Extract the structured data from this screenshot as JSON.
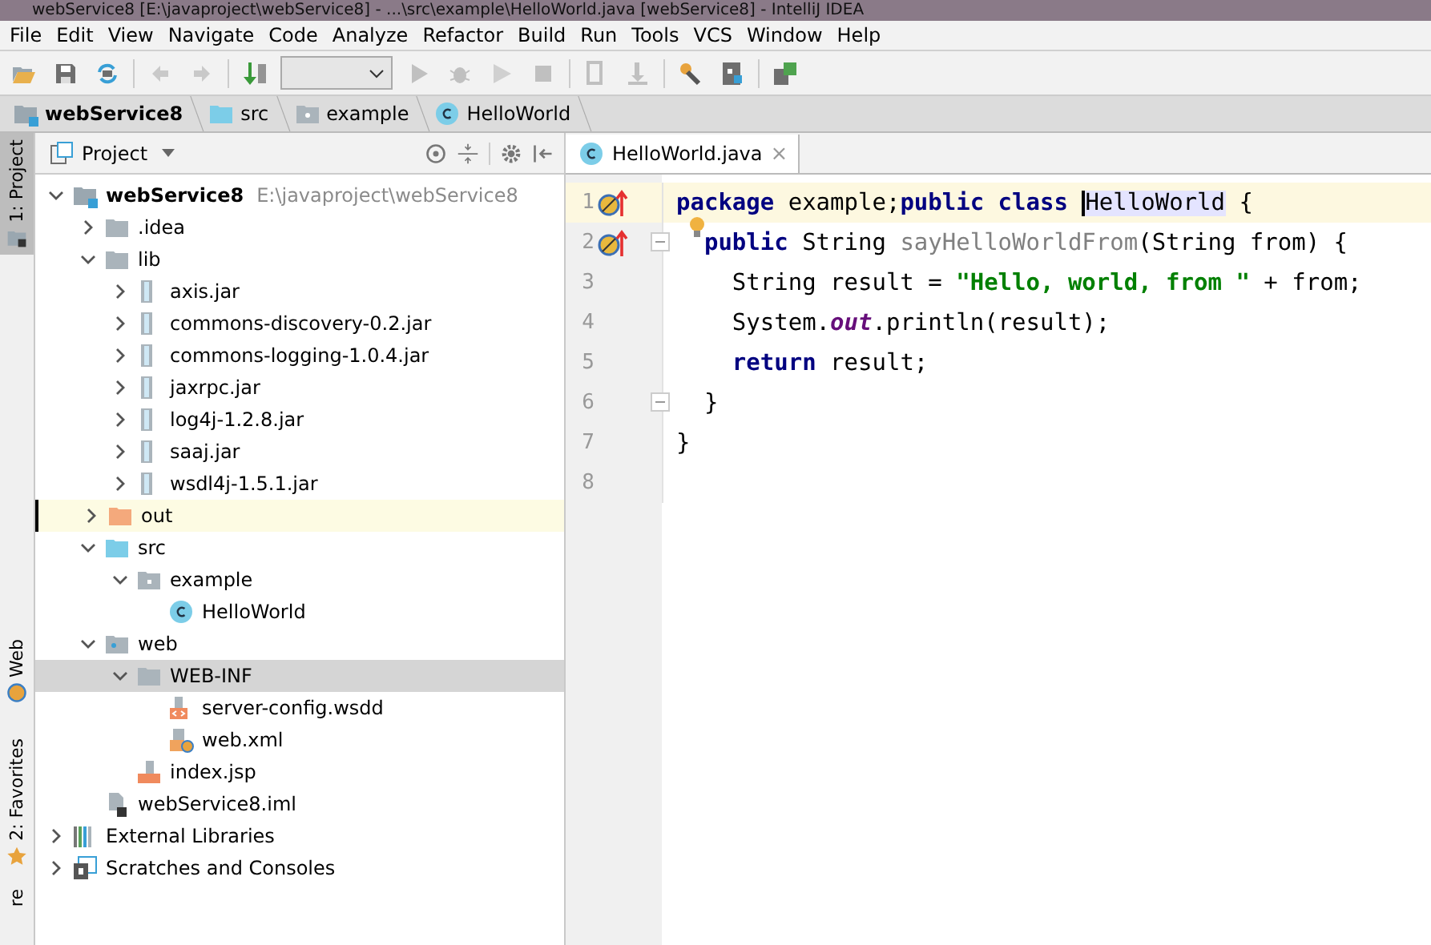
{
  "window": {
    "title": "webService8 [E:\\javaproject\\webService8] - ...\\src\\example\\HelloWorld.java [webService8] - IntelliJ IDEA"
  },
  "menu": [
    "File",
    "Edit",
    "View",
    "Navigate",
    "Code",
    "Analyze",
    "Refactor",
    "Build",
    "Run",
    "Tools",
    "VCS",
    "Window",
    "Help"
  ],
  "breadcrumb": [
    {
      "label": "webService8",
      "kind": "module"
    },
    {
      "label": "src",
      "kind": "source"
    },
    {
      "label": "example",
      "kind": "package"
    },
    {
      "label": "HelloWorld",
      "kind": "class"
    }
  ],
  "side_tabs": [
    {
      "label": "1: Project",
      "kind": "project",
      "selected": true
    },
    {
      "label": "Web",
      "kind": "web",
      "selected": false
    },
    {
      "label": "2: Favorites",
      "kind": "star",
      "selected": false
    },
    {
      "label": "re",
      "kind": "plain",
      "selected": false
    }
  ],
  "project_panel": {
    "title": "Project",
    "tree": [
      {
        "label": "webService8",
        "path": "E:\\javaproject\\webService8",
        "kind": "module",
        "expanded": true,
        "selected": false,
        "highlighted": false,
        "children": [
          {
            "label": ".idea",
            "kind": "folder",
            "expanded": false,
            "selected": false,
            "highlighted": false
          },
          {
            "label": "lib",
            "kind": "folder",
            "expanded": true,
            "selected": false,
            "highlighted": false,
            "children": [
              {
                "label": "axis.jar",
                "kind": "jar",
                "expanded": false,
                "selected": false,
                "highlighted": false
              },
              {
                "label": "commons-discovery-0.2.jar",
                "kind": "jar",
                "expanded": false,
                "selected": false,
                "highlighted": false
              },
              {
                "label": "commons-logging-1.0.4.jar",
                "kind": "jar",
                "expanded": false,
                "selected": false,
                "highlighted": false
              },
              {
                "label": "jaxrpc.jar",
                "kind": "jar",
                "expanded": false,
                "selected": false,
                "highlighted": false
              },
              {
                "label": "log4j-1.2.8.jar",
                "kind": "jar",
                "expanded": false,
                "selected": false,
                "highlighted": false
              },
              {
                "label": "saaj.jar",
                "kind": "jar",
                "expanded": false,
                "selected": false,
                "highlighted": false
              },
              {
                "label": "wsdl4j-1.5.1.jar",
                "kind": "jar",
                "expanded": false,
                "selected": false,
                "highlighted": false
              }
            ]
          },
          {
            "label": "out",
            "kind": "excluded",
            "expanded": false,
            "selected": false,
            "highlighted": true
          },
          {
            "label": "src",
            "kind": "source",
            "expanded": true,
            "selected": false,
            "highlighted": false,
            "children": [
              {
                "label": "example",
                "kind": "package",
                "expanded": true,
                "selected": false,
                "highlighted": false,
                "children": [
                  {
                    "label": "HelloWorld",
                    "kind": "class",
                    "selected": false,
                    "highlighted": false
                  }
                ]
              }
            ]
          },
          {
            "label": "web",
            "kind": "webfolder",
            "expanded": true,
            "selected": false,
            "highlighted": false,
            "children": [
              {
                "label": "WEB-INF",
                "kind": "folder",
                "expanded": true,
                "selected": true,
                "highlighted": false,
                "children": [
                  {
                    "label": "server-config.wsdd",
                    "kind": "xml",
                    "selected": false,
                    "highlighted": false
                  },
                  {
                    "label": "web.xml",
                    "kind": "webxml",
                    "selected": false,
                    "highlighted": false
                  }
                ]
              },
              {
                "label": "index.jsp",
                "kind": "jsp",
                "selected": false,
                "highlighted": false
              }
            ]
          },
          {
            "label": "webService8.iml",
            "kind": "iml",
            "selected": false,
            "highlighted": false
          }
        ]
      },
      {
        "label": "External Libraries",
        "kind": "libraries",
        "expanded": false,
        "selected": false,
        "highlighted": false
      },
      {
        "label": "Scratches and Consoles",
        "kind": "scratches",
        "expanded": false,
        "selected": false,
        "highlighted": false
      }
    ]
  },
  "editor": {
    "tabs": [
      {
        "label": "HelloWorld.java",
        "close": "×",
        "selected": true
      }
    ],
    "lines": [
      {
        "number": "1",
        "current": true,
        "gutter_icon": true,
        "tokens": [
          {
            "kind": "keyword",
            "text": "package"
          },
          {
            "kind": "text",
            "text": " example;"
          },
          {
            "kind": "keyword",
            "text": "public class "
          },
          {
            "kind": "highlight",
            "text": "HelloWorld"
          },
          {
            "kind": "text",
            "text": " {"
          }
        ]
      },
      {
        "number": "2",
        "current": false,
        "gutter_icon": true,
        "bulb": true,
        "fold": true,
        "tokens": [
          {
            "kind": "keyword",
            "text": "  public"
          },
          {
            "kind": "text",
            "text": " String "
          },
          {
            "kind": "unused",
            "text": "sayHelloWorldFrom"
          },
          {
            "kind": "text",
            "text": "(String from) {"
          }
        ]
      },
      {
        "number": "3",
        "current": false,
        "tokens": [
          {
            "kind": "text",
            "text": "    String result = "
          },
          {
            "kind": "string",
            "text": "\"Hello, world, from \""
          },
          {
            "kind": "text",
            "text": " + from;"
          }
        ]
      },
      {
        "number": "4",
        "current": false,
        "tokens": [
          {
            "kind": "text",
            "text": "    System."
          },
          {
            "kind": "static",
            "text": "out"
          },
          {
            "kind": "text",
            "text": ".println(result);"
          }
        ]
      },
      {
        "number": "5",
        "current": false,
        "tokens": [
          {
            "kind": "keyword",
            "text": "    return"
          },
          {
            "kind": "text",
            "text": " result;"
          }
        ]
      },
      {
        "number": "6",
        "current": false,
        "fold": true,
        "tokens": [
          {
            "kind": "text",
            "text": "  }"
          }
        ]
      },
      {
        "number": "7",
        "current": false,
        "tokens": [
          {
            "kind": "text",
            "text": "}"
          }
        ]
      },
      {
        "number": "8",
        "current": false
      }
    ]
  }
}
